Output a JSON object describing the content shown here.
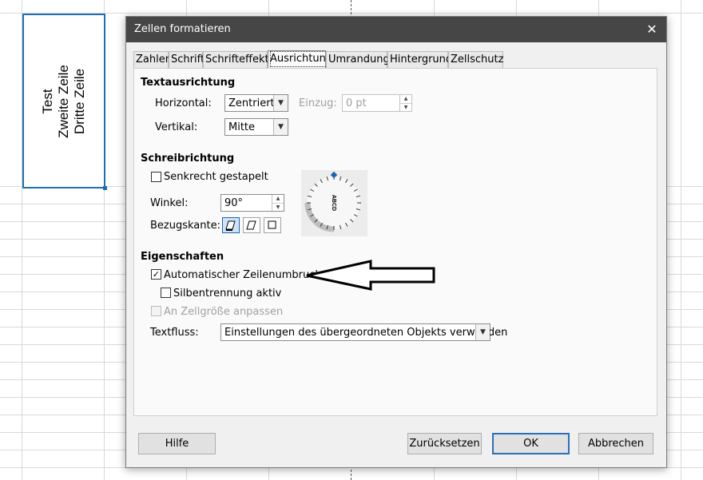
{
  "sheet": {
    "cell_lines": [
      "Test",
      "Zweite Zeile",
      "Dritte Zeile"
    ]
  },
  "dialog": {
    "title": "Zellen formatieren",
    "close_glyph": "✕",
    "tabs": [
      {
        "label": "Zahlen",
        "active": false
      },
      {
        "label": "Schrift",
        "active": false
      },
      {
        "label": "Schrifteffekte",
        "active": false
      },
      {
        "label": "Ausrichtung",
        "active": true
      },
      {
        "label": "Umrandung",
        "active": false
      },
      {
        "label": "Hintergrund",
        "active": false
      },
      {
        "label": "Zellschutz",
        "active": false
      }
    ],
    "text_alignment": {
      "title": "Textausrichtung",
      "horizontal_label": "Horizontal:",
      "horizontal_value": "Zentriert",
      "indent_label": "Einzug:",
      "indent_value": "0 pt",
      "vertical_label": "Vertikal:",
      "vertical_value": "Mitte"
    },
    "text_orientation": {
      "title": "Schreibrichtung",
      "stacked_label": "Senkrecht gestapelt",
      "stacked_checked": false,
      "angle_label": "Winkel:",
      "angle_value": "90°",
      "reference_edge_label": "Bezugskante:",
      "dial_text": "ABCD"
    },
    "properties": {
      "title": "Eigenschaften",
      "wrap_label": "Automatischer Zeilenumbruch",
      "wrap_checked": true,
      "hyphenation_label": "Silbentrennung aktiv",
      "hyphenation_checked": false,
      "shrink_label": "An Zellgröße anpassen",
      "shrink_checked": false,
      "textflow_label": "Textfluss:",
      "textflow_value": "Einstellungen des übergeordneten Objekts verwenden"
    },
    "buttons": {
      "help": "Hilfe",
      "reset": "Zurücksetzen",
      "ok": "OK",
      "cancel": "Abbrechen"
    }
  },
  "icons": {
    "close": "close-icon",
    "combo_arrow": "chevron-down-icon",
    "spin": "spin-arrows-icon",
    "annotation": "arrow-left-icon"
  },
  "colors": {
    "titlebar": "#464646",
    "selection": "#1f6fb4",
    "default_button_border": "#2a6ebd"
  }
}
